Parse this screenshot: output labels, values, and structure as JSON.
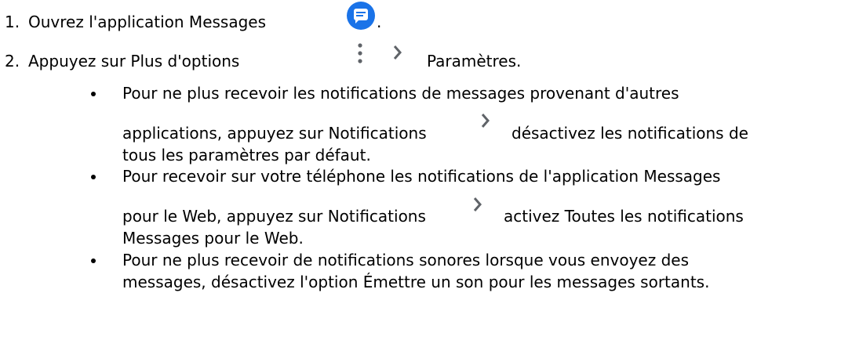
{
  "steps": [
    {
      "number": "1.",
      "text": "Ouvrez l'application Messages",
      "trail": ".",
      "icon": "messages-app-icon"
    },
    {
      "number": "2.",
      "text_before": "Appuyez sur Plus d'options",
      "text_after": "Paramètres.",
      "icons": [
        "more-options-icon",
        "chevron-right-icon"
      ],
      "bullets": [
        {
          "line1": "Pour ne plus recevoir les notifications de messages provenant d'autres",
          "line2_before": "applications, appuyez sur Notifications",
          "line2_after": "désactivez les notifications de",
          "line3": "tous les paramètres par défaut.",
          "icon": "chevron-right-icon"
        },
        {
          "line1": "Pour recevoir sur votre téléphone les notifications de l'application Messages",
          "line2_before": "pour le Web, appuyez sur Notifications",
          "line2_after": "activez Toutes les notifications",
          "line3": "Messages pour le Web.",
          "icon": "chevron-right-icon"
        },
        {
          "line1": "Pour ne plus recevoir de notifications sonores lorsque vous envoyez des",
          "line2": "messages, désactivez l'option Émettre un son pour les messages sortants."
        }
      ]
    }
  ],
  "colors": {
    "messages_icon_bg": "#1a73e8",
    "chevron_gray": "#5f6368",
    "text": "#000000"
  }
}
